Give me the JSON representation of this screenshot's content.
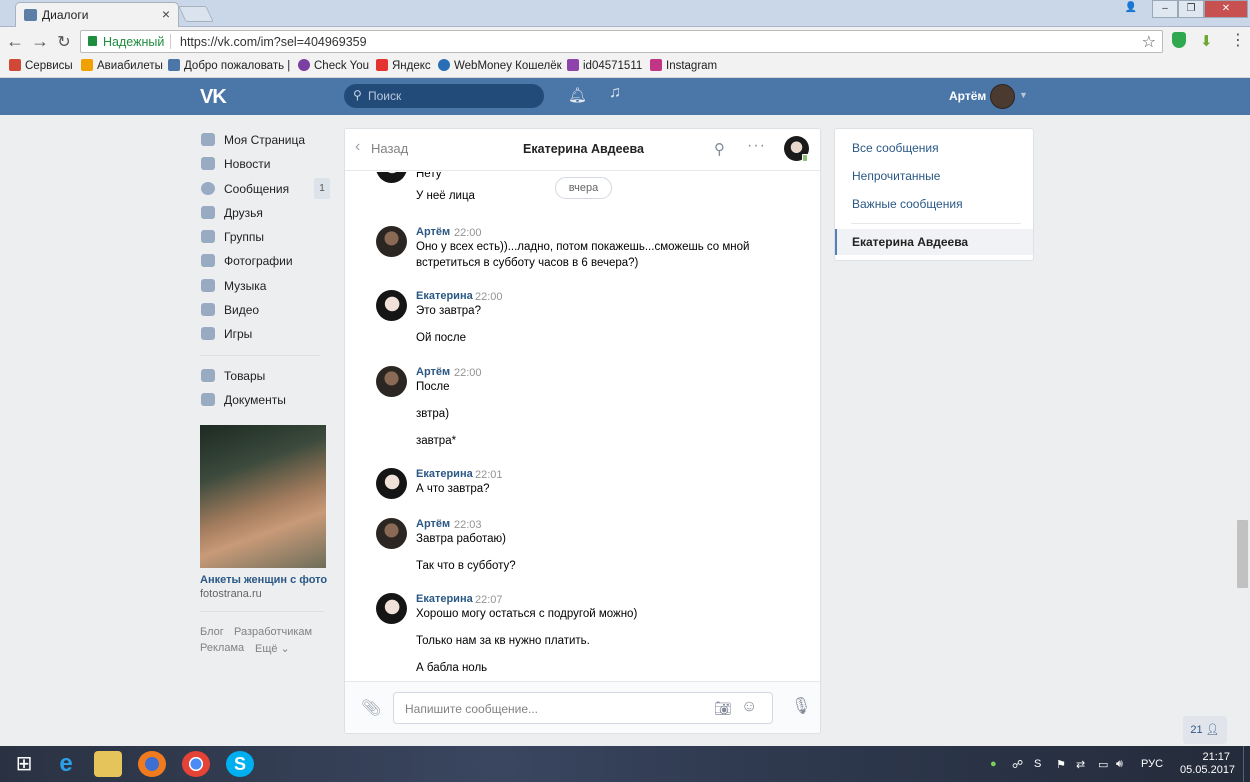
{
  "browser": {
    "tab_title": "Диалоги",
    "secure_label": "Надежный",
    "url": "https://vk.com/im?sel=404969359",
    "bookmarks": [
      {
        "label": "Сервисы",
        "color": "#d14836"
      },
      {
        "label": "Авиабилеты",
        "color": "#f0a000"
      },
      {
        "label": "Добро пожаловать |",
        "color": "#4a76a8"
      },
      {
        "label": "Check You",
        "color": "#7b3fa0"
      },
      {
        "label": "Яндекс",
        "color": "#e3342f"
      },
      {
        "label": "WebMoney Кошелёк",
        "color": "#2a6fb5"
      },
      {
        "label": "id04571511",
        "color": "#8e44ad"
      },
      {
        "label": "Instagram",
        "color": "#c13584"
      }
    ]
  },
  "vk_header": {
    "search_placeholder": "Поиск",
    "user_name": "Артём"
  },
  "left_nav": {
    "items": [
      {
        "label": "Моя Страница",
        "icon": "home-icon"
      },
      {
        "label": "Новости",
        "icon": "news-icon"
      },
      {
        "label": "Сообщения",
        "icon": "messages-icon",
        "count": "1"
      },
      {
        "label": "Друзья",
        "icon": "friends-icon"
      },
      {
        "label": "Группы",
        "icon": "groups-icon"
      },
      {
        "label": "Фотографии",
        "icon": "photos-icon"
      },
      {
        "label": "Музыка",
        "icon": "music-icon"
      },
      {
        "label": "Видео",
        "icon": "video-icon"
      },
      {
        "label": "Игры",
        "icon": "games-icon"
      }
    ],
    "items2": [
      {
        "label": "Товары",
        "icon": "goods-icon"
      },
      {
        "label": "Документы",
        "icon": "documents-icon"
      }
    ],
    "ad": {
      "title": "Анкеты женщин с фото",
      "site": "fotostrana.ru"
    },
    "footer": {
      "blog": "Блог",
      "developers": "Разработчикам",
      "ads": "Реклама",
      "more": "Ещё ⌄"
    }
  },
  "dialog": {
    "back_label": "Назад",
    "title": "Екатерина Авдеева",
    "date_divider": "вчера",
    "top_messages": [
      "Нету",
      "У неё лица"
    ],
    "groups": [
      {
        "author": "Артём",
        "avatar": "artem",
        "time": "22:00",
        "messages": [
          "Оно у всех есть))...ладно, потом покажешь...сможешь со мной встретиться в субботу часов в 6 вечера?)"
        ]
      },
      {
        "author": "Екатерина",
        "avatar": "kate",
        "time": "22:00",
        "messages": [
          "Это завтра?",
          "Ой после"
        ]
      },
      {
        "author": "Артём",
        "avatar": "artem",
        "time": "22:00",
        "messages": [
          "После",
          "звтра)",
          "завтра*"
        ]
      },
      {
        "author": "Екатерина",
        "avatar": "kate",
        "time": "22:01",
        "messages": [
          "А что завтра?"
        ]
      },
      {
        "author": "Артём",
        "avatar": "artem",
        "time": "22:03",
        "messages": [
          "Завтра работаю)",
          "Так что в субботу?"
        ]
      },
      {
        "author": "Екатерина",
        "avatar": "kate",
        "time": "22:07",
        "messages": [
          "Хорошо могу остаться с подругой можно)",
          "Только нам за кв нужно платить.",
          "А бабла ноль"
        ]
      }
    ],
    "composer_placeholder": "Напишите сообщение..."
  },
  "right_menu": {
    "all": "Все сообщения",
    "unread": "Непрочитанные",
    "important": "Важные сообщения",
    "active_dialog": "Екатерина Авдеева"
  },
  "online_count": "21",
  "taskbar": {
    "lang": "РУС",
    "time": "21:17",
    "date": "05.05.2017"
  }
}
